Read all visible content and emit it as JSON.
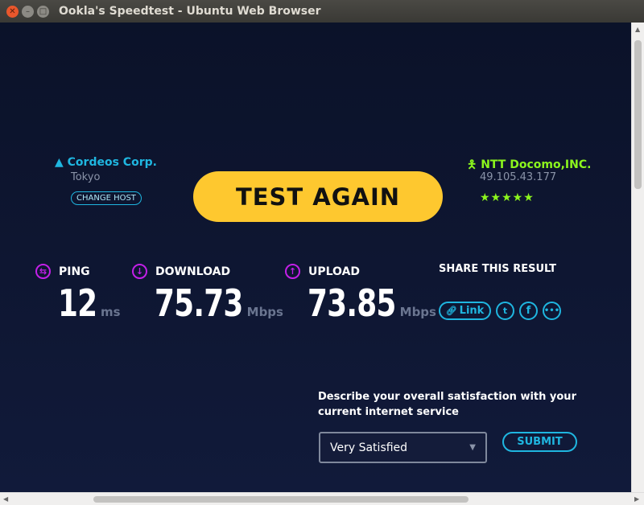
{
  "window": {
    "title": "Ookla's Speedtest - Ubuntu Web Browser"
  },
  "server": {
    "name": "Cordeos Corp.",
    "location": "Tokyo",
    "change_label": "CHANGE HOST"
  },
  "isp": {
    "name": "NTT Docomo,INC.",
    "ip": "49.105.43.177",
    "rating_stars": 5,
    "stars_text": "★★★★★"
  },
  "test_again_label": "TEST AGAIN",
  "metrics": {
    "ping": {
      "label": "PING",
      "value": "12",
      "unit": "ms"
    },
    "download": {
      "label": "DOWNLOAD",
      "value": "75.73",
      "unit": "Mbps"
    },
    "upload": {
      "label": "UPLOAD",
      "value": "73.85",
      "unit": "Mbps"
    }
  },
  "share": {
    "title": "SHARE THIS RESULT",
    "link_label": "Link"
  },
  "survey": {
    "question": "Describe your overall satisfaction with your current internet service",
    "selected": "Very Satisfied",
    "submit_label": "SUBMIT"
  },
  "colors": {
    "accent": "#1fb6e0",
    "isp": "#8cf51d",
    "button": "#fec82f",
    "metric_icon": "#c31fe8"
  }
}
